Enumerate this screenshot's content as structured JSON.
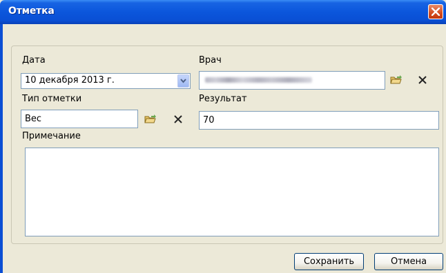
{
  "window": {
    "title": "Отметка",
    "close_icon": "close-icon"
  },
  "form": {
    "date_label": "Дата",
    "date_value": "10 декабря 2013 г.",
    "doctor_label": "Врач",
    "doctor_value": "",
    "mark_type_label": "Тип отметки",
    "mark_type_value": "Вес",
    "result_label": "Результат",
    "result_value": "70",
    "note_label": "Примечание",
    "note_value": ""
  },
  "buttons": {
    "save": "Сохранить",
    "cancel": "Отмена"
  },
  "colors": {
    "title_bar": "#0b56dc",
    "close_button": "#d34b1f",
    "dialog_bg": "#ece9d8",
    "field_border": "#7f9db9"
  }
}
